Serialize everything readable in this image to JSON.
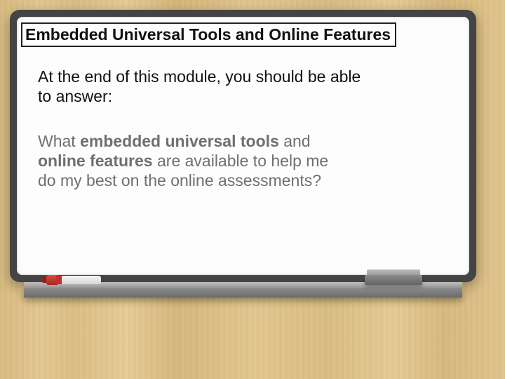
{
  "title": "Embedded Universal Tools and Online Features",
  "intro": "At the end of this module, you should be able to answer:",
  "question": {
    "prefix": "What ",
    "bold1": "embedded universal tools",
    "mid1": " and ",
    "bold2": "online features",
    "suffix": " are available to help me do my best on the online assessments?"
  }
}
